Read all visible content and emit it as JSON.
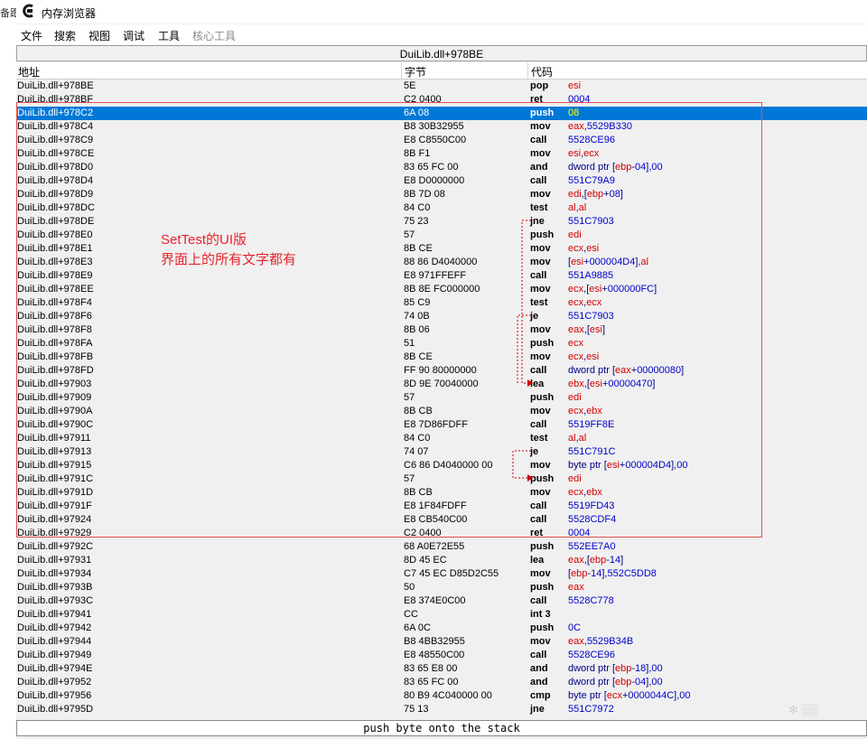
{
  "window": {
    "title": "内存浏览器",
    "left_edge_text": "备跟"
  },
  "menu": [
    "文件",
    "搜索",
    "视图",
    "调试",
    "工具",
    "核心工具"
  ],
  "address_bar": "DuiLib.dll+978BE",
  "columns": {
    "addr": "地址",
    "bytes": "字节",
    "code": "代码"
  },
  "rows": [
    {
      "addr": "DuiLib.dll+978BE",
      "bytes": "5E",
      "op": "pop",
      "args": "esi"
    },
    {
      "addr": "DuiLib.dll+978BF",
      "bytes": "C2 0400",
      "op": "ret",
      "args": "0004"
    },
    {
      "addr": "DuiLib.dll+978C2",
      "bytes": "6A 08",
      "op": "push",
      "args": "08",
      "selected": true
    },
    {
      "addr": "DuiLib.dll+978C4",
      "bytes": "B8 30B32955",
      "op": "mov",
      "args": "eax,5529B330"
    },
    {
      "addr": "DuiLib.dll+978C9",
      "bytes": "E8 C8550C00",
      "op": "call",
      "args": "5528CE96"
    },
    {
      "addr": "DuiLib.dll+978CE",
      "bytes": "8B F1",
      "op": "mov",
      "args": "esi,ecx"
    },
    {
      "addr": "DuiLib.dll+978D0",
      "bytes": "83 65 FC 00",
      "op": "and",
      "args": "dword ptr [ebp-04],00"
    },
    {
      "addr": "DuiLib.dll+978D4",
      "bytes": "E8 D0000000",
      "op": "call",
      "args": "551C79A9"
    },
    {
      "addr": "DuiLib.dll+978D9",
      "bytes": "8B 7D 08",
      "op": "mov",
      "args": "edi,[ebp+08]"
    },
    {
      "addr": "DuiLib.dll+978DC",
      "bytes": "84 C0",
      "op": "test",
      "args": "al,al"
    },
    {
      "addr": "DuiLib.dll+978DE",
      "bytes": "75 23",
      "op": "jne",
      "args": "551C7903"
    },
    {
      "addr": "DuiLib.dll+978E0",
      "bytes": "57",
      "op": "push",
      "args": "edi"
    },
    {
      "addr": "DuiLib.dll+978E1",
      "bytes": "8B CE",
      "op": "mov",
      "args": "ecx,esi"
    },
    {
      "addr": "DuiLib.dll+978E3",
      "bytes": "88 86 D4040000",
      "op": "mov",
      "args": "[esi+000004D4],al"
    },
    {
      "addr": "DuiLib.dll+978E9",
      "bytes": "E8 971FFEFF",
      "op": "call",
      "args": "551A9885"
    },
    {
      "addr": "DuiLib.dll+978EE",
      "bytes": "8B 8E FC000000",
      "op": "mov",
      "args": "ecx,[esi+000000FC]"
    },
    {
      "addr": "DuiLib.dll+978F4",
      "bytes": "85 C9",
      "op": "test",
      "args": "ecx,ecx"
    },
    {
      "addr": "DuiLib.dll+978F6",
      "bytes": "74 0B",
      "op": "je",
      "args": "551C7903"
    },
    {
      "addr": "DuiLib.dll+978F8",
      "bytes": "8B 06",
      "op": "mov",
      "args": "eax,[esi]"
    },
    {
      "addr": "DuiLib.dll+978FA",
      "bytes": "51",
      "op": "push",
      "args": "ecx"
    },
    {
      "addr": "DuiLib.dll+978FB",
      "bytes": "8B CE",
      "op": "mov",
      "args": "ecx,esi"
    },
    {
      "addr": "DuiLib.dll+978FD",
      "bytes": "FF 90 80000000",
      "op": "call",
      "args": "dword ptr [eax+00000080]"
    },
    {
      "addr": "DuiLib.dll+97903",
      "bytes": "8D 9E 70040000",
      "op": "lea",
      "args": "ebx,[esi+00000470]"
    },
    {
      "addr": "DuiLib.dll+97909",
      "bytes": "57",
      "op": "push",
      "args": "edi"
    },
    {
      "addr": "DuiLib.dll+9790A",
      "bytes": "8B CB",
      "op": "mov",
      "args": "ecx,ebx"
    },
    {
      "addr": "DuiLib.dll+9790C",
      "bytes": "E8 7D86FDFF",
      "op": "call",
      "args": "5519FF8E"
    },
    {
      "addr": "DuiLib.dll+97911",
      "bytes": "84 C0",
      "op": "test",
      "args": "al,al"
    },
    {
      "addr": "DuiLib.dll+97913",
      "bytes": "74 07",
      "op": "je",
      "args": "551C791C"
    },
    {
      "addr": "DuiLib.dll+97915",
      "bytes": "C6 86 D4040000 00",
      "op": "mov",
      "args": "byte ptr [esi+000004D4],00"
    },
    {
      "addr": "DuiLib.dll+9791C",
      "bytes": "57",
      "op": "push",
      "args": "edi"
    },
    {
      "addr": "DuiLib.dll+9791D",
      "bytes": "8B CB",
      "op": "mov",
      "args": "ecx,ebx"
    },
    {
      "addr": "DuiLib.dll+9791F",
      "bytes": "E8 1F84FDFF",
      "op": "call",
      "args": "5519FD43"
    },
    {
      "addr": "DuiLib.dll+97924",
      "bytes": "E8 CB540C00",
      "op": "call",
      "args": "5528CDF4"
    },
    {
      "addr": "DuiLib.dll+97929",
      "bytes": "C2 0400",
      "op": "ret",
      "args": "0004"
    },
    {
      "addr": "DuiLib.dll+9792C",
      "bytes": "68 A0E72E55",
      "op": "push",
      "args": "552EE7A0"
    },
    {
      "addr": "DuiLib.dll+97931",
      "bytes": "8D 45 EC",
      "op": "lea",
      "args": "eax,[ebp-14]"
    },
    {
      "addr": "DuiLib.dll+97934",
      "bytes": "C7 45 EC D85D2C55",
      "op": "mov",
      "args": "[ebp-14],552C5DD8"
    },
    {
      "addr": "DuiLib.dll+9793B",
      "bytes": "50",
      "op": "push",
      "args": "eax"
    },
    {
      "addr": "DuiLib.dll+9793C",
      "bytes": "E8 374E0C00",
      "op": "call",
      "args": "5528C778"
    },
    {
      "addr": "DuiLib.dll+97941",
      "bytes": "CC",
      "op": "int 3",
      "args": ""
    },
    {
      "addr": "DuiLib.dll+97942",
      "bytes": "6A 0C",
      "op": "push",
      "args": "0C"
    },
    {
      "addr": "DuiLib.dll+97944",
      "bytes": "B8 4BB32955",
      "op": "mov",
      "args": "eax,5529B34B"
    },
    {
      "addr": "DuiLib.dll+97949",
      "bytes": "E8 48550C00",
      "op": "call",
      "args": "5528CE96"
    },
    {
      "addr": "DuiLib.dll+9794E",
      "bytes": "83 65 E8 00",
      "op": "and",
      "args": "dword ptr [ebp-18],00"
    },
    {
      "addr": "DuiLib.dll+97952",
      "bytes": "83 65 FC 00",
      "op": "and",
      "args": "dword ptr [ebp-04],00"
    },
    {
      "addr": "DuiLib.dll+97956",
      "bytes": "80 B9 4C040000 00",
      "op": "cmp",
      "args": "byte ptr [ecx+0000044C],00"
    },
    {
      "addr": "DuiLib.dll+9795D",
      "bytes": "75 13",
      "op": "jne",
      "args": "551C7972"
    }
  ],
  "annotation": [
    "SetTest的UI版",
    "界面上的所有文字都有"
  ],
  "status": "push byte onto the stack",
  "colors": {
    "selected": "#0078d7",
    "register": "#d40000",
    "number": "#0000cc",
    "annotation": "#e8232d"
  }
}
